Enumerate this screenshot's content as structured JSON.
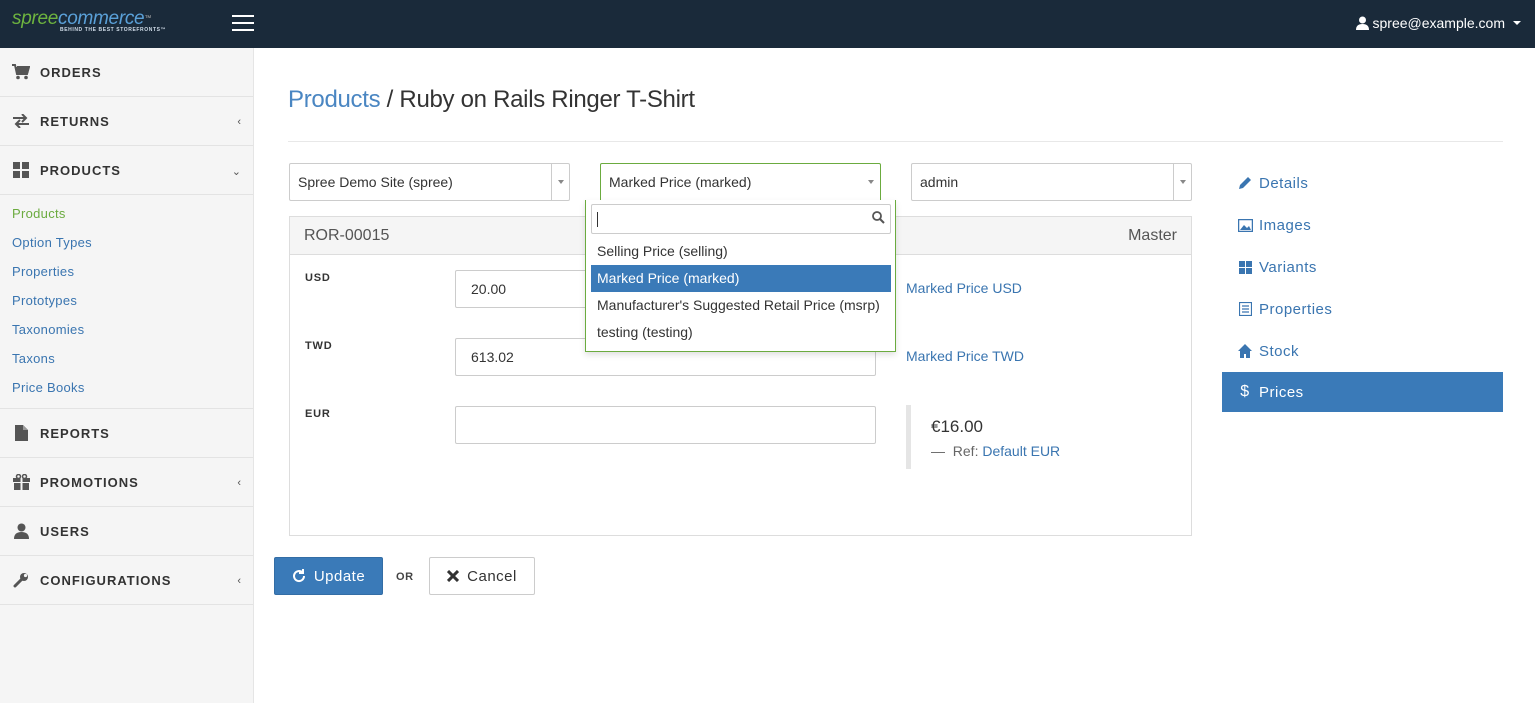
{
  "header": {
    "logo_text_a": "spree",
    "logo_text_b": "commerce",
    "logo_tagline": "BEHIND THE BEST STOREFRONTS™",
    "user_email": "spree@example.com"
  },
  "sidebar": {
    "orders": "ORDERS",
    "returns": "RETURNS",
    "products": "PRODUCTS",
    "product_links": [
      "Products",
      "Option Types",
      "Properties",
      "Prototypes",
      "Taxonomies",
      "Taxons",
      "Price Books"
    ],
    "reports": "REPORTS",
    "promotions": "PROMOTIONS",
    "users": "USERS",
    "configurations": "CONFIGURATIONS"
  },
  "page": {
    "breadcrumb": "Products",
    "separator": " / ",
    "title": "Ruby on Rails Ringer T-Shirt"
  },
  "filters": {
    "store": "Spree Demo Site (spree)",
    "price_book": "Marked Price (marked)",
    "role": "admin"
  },
  "dropdown": {
    "search_value": "",
    "options": [
      "Selling Price (selling)",
      "Marked Price (marked)",
      "Manufacturer's Suggested Retail Price (msrp)",
      "testing (testing)"
    ],
    "highlighted": "Marked Price (marked)"
  },
  "panel": {
    "sku": "ROR-00015",
    "variant": "Master",
    "rows": [
      {
        "currency": "USD",
        "value": "20.00",
        "link": "Marked Price USD"
      },
      {
        "currency": "TWD",
        "value": "613.02",
        "link": "Marked Price TWD"
      },
      {
        "currency": "EUR",
        "value": ""
      }
    ],
    "ref_amount": "€16.00",
    "ref_dash": "—",
    "ref_label": "Ref:",
    "ref_link": "Default EUR"
  },
  "actions": {
    "update": "Update",
    "or": "OR",
    "cancel": "Cancel"
  },
  "tabs": [
    "Details",
    "Images",
    "Variants",
    "Properties",
    "Stock",
    "Prices"
  ],
  "active_tab": "Prices",
  "colors": {
    "topbar": "#1a2a3a",
    "primary": "#3a7ab8",
    "link": "#3a75b0",
    "green": "#6bab3f"
  }
}
